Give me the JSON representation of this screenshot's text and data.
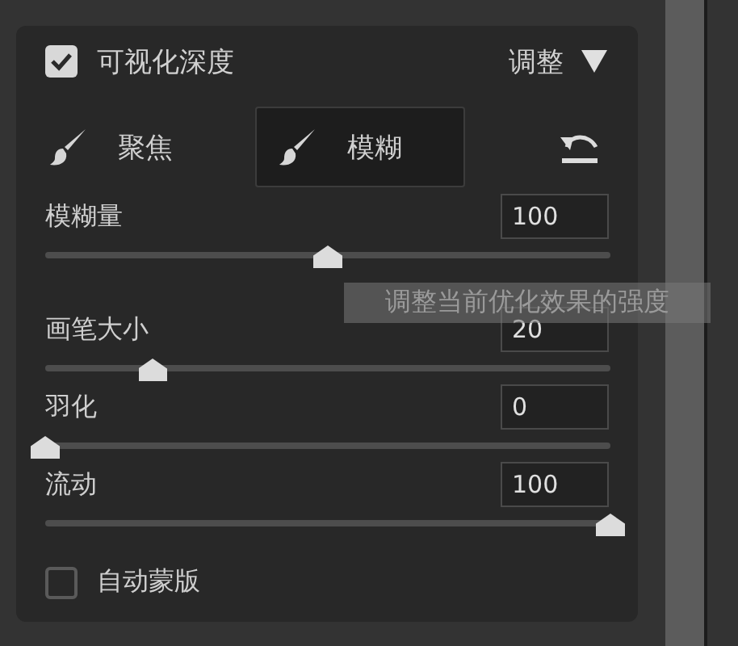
{
  "header": {
    "title": "可视化深度",
    "checked": true,
    "menu": "调整"
  },
  "tabs": [
    {
      "label": "聚焦",
      "selected": false
    },
    {
      "label": "模糊",
      "selected": true
    }
  ],
  "sliders": [
    {
      "label": "模糊量",
      "value": "100",
      "level": 0.5
    },
    {
      "label": "画笔大小",
      "value": "20",
      "level": 0.19
    },
    {
      "label": "羽化",
      "value": "0",
      "level": 0
    },
    {
      "label": "流动",
      "value": "100",
      "level": 1
    }
  ],
  "tooltip": "调整当前优化效果的强度",
  "auto_mask": {
    "label": "自动蒙版",
    "checked": false
  }
}
